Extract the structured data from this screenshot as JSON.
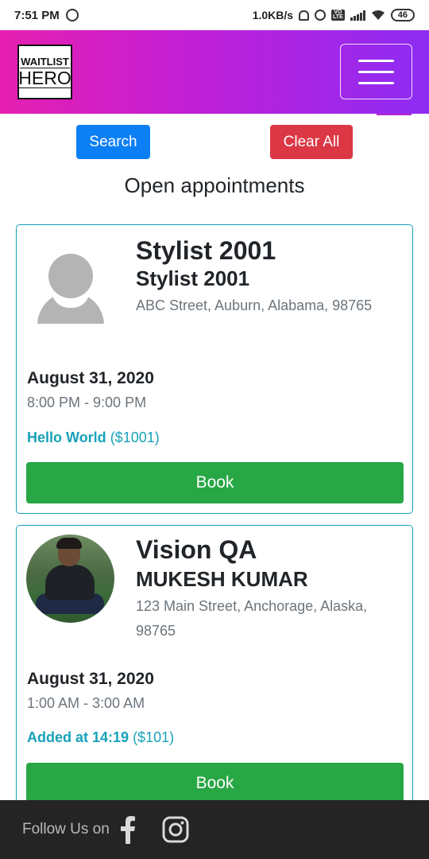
{
  "status_bar": {
    "time": "7:51 PM",
    "net_speed": "1.0KB/s",
    "battery": "46"
  },
  "header": {
    "logo_line1": "WAITLIST",
    "logo_line2": "HERO",
    "gradient_start": "#e51fb0",
    "gradient_end": "#8d2cf3"
  },
  "filters": {
    "search_label": "Search",
    "clear_label": "Clear All"
  },
  "section_title": "Open appointments",
  "appointments": [
    {
      "title": "Stylist 2001",
      "name": "Stylist 2001",
      "address": "ABC Street, Auburn, Alabama, 98765",
      "date": "August 31, 2020",
      "time": "8:00 PM - 9:00 PM",
      "service": "Hello World",
      "price": "($1001)",
      "book_label": "Book",
      "avatar": "default-avatar-icon"
    },
    {
      "title": "Vision QA",
      "name": "MUKESH KUMAR",
      "address": "123 Main Street, Anchorage, Alaska, 98765",
      "date": "August 31, 2020",
      "time": "1:00 AM - 3:00 AM",
      "service": "Added at 14:19",
      "price": "($101)",
      "book_label": "Book",
      "avatar": "profile-photo"
    }
  ],
  "footer": {
    "follow_label": "Follow Us on",
    "icons": [
      "facebook-icon",
      "instagram-icon"
    ]
  },
  "colors": {
    "primary": "#0d7ff5",
    "danger": "#db3744",
    "success": "#28a745",
    "info": "#17a2b8",
    "footer_bg": "#242424"
  }
}
